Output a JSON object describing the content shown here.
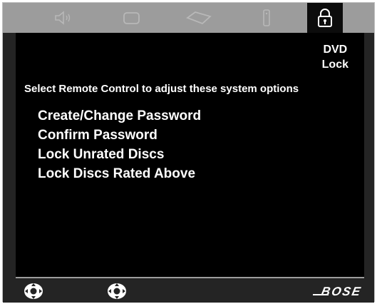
{
  "tabs": [
    {
      "id": "audio",
      "icon": "speaker-icon"
    },
    {
      "id": "video",
      "icon": "tv-screen-icon"
    },
    {
      "id": "disc",
      "icon": "disc-tray-icon"
    },
    {
      "id": "remote",
      "icon": "remote-icon"
    },
    {
      "id": "lock",
      "icon": "padlock-icon",
      "active": true
    }
  ],
  "screen": {
    "title_line1": "DVD",
    "title_line2": "Lock",
    "instruction": "Select Remote Control to adjust these system options",
    "options": [
      "Create/Change Password",
      "Confirm Password",
      "Lock Unrated Discs",
      "Lock Discs Rated Above"
    ]
  },
  "footer": {
    "brand": "BOSE",
    "left_icon": "navigation-pad-icon",
    "center_icon": "navigation-pad-icon"
  },
  "colors": {
    "tab_bar": "#9c9c9c",
    "active_tab": "#0c0c0c",
    "screen": "#000000",
    "frame": "#242424",
    "text": "#ffffff"
  }
}
